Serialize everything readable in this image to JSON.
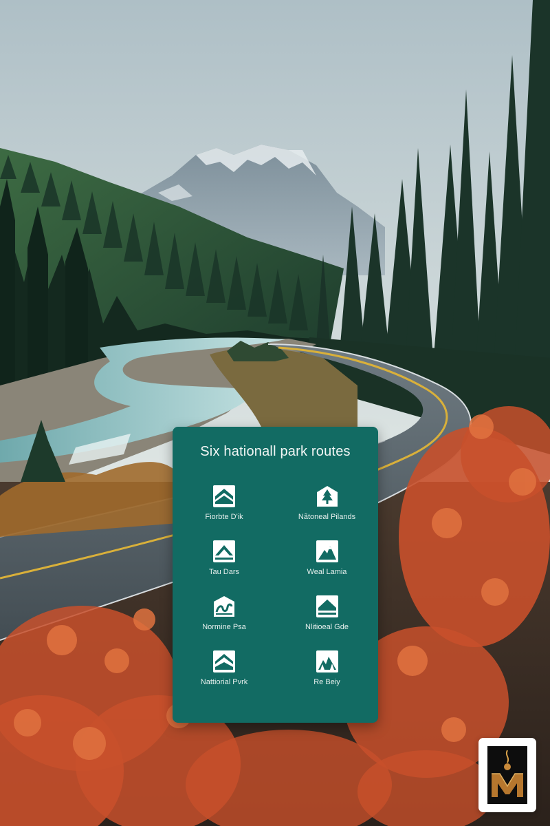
{
  "card": {
    "title": "Six hationall park routes",
    "background": "#126b63",
    "routes": [
      {
        "label": "Fiorbte D'ik",
        "icon": "mountain-chevron-icon"
      },
      {
        "label": "Nãtoneal Pilands",
        "icon": "tree-badge-icon"
      },
      {
        "label": "Tau Dars",
        "icon": "mountain-chevron-icon"
      },
      {
        "label": "Weal Lamia",
        "icon": "mountain-peak-icon"
      },
      {
        "label": "Normine Psa",
        "icon": "winding-road-icon"
      },
      {
        "label": "Nlitioeal Gde",
        "icon": "mountain-chevron-icon"
      },
      {
        "label": "Nattiorial Pvrk",
        "icon": "mountain-chevron-icon"
      },
      {
        "label": "Re Beiy",
        "icon": "forest-peak-icon"
      }
    ]
  },
  "colors": {
    "sky": "#c9d6da",
    "forest": "#1e3a2e",
    "river": "#8fc3c6",
    "road": "#4f5a60",
    "foliage": "#c8502b"
  }
}
